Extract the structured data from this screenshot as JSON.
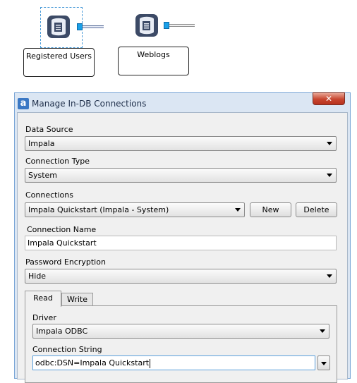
{
  "canvas": {
    "tools": [
      {
        "annotation": "Registered Users",
        "selected": true
      },
      {
        "annotation": "Weblogs",
        "selected": false
      }
    ]
  },
  "dialog": {
    "title": "Manage In-DB Connections",
    "close_symbol": "✕",
    "logo_letter": "a",
    "data_source": {
      "label": "Data Source",
      "value": "Impala"
    },
    "connection_type": {
      "label": "Connection Type",
      "value": "System"
    },
    "connections": {
      "label": "Connections",
      "value": "Impala Quickstart (Impala - System)",
      "new_label": "New",
      "delete_label": "Delete"
    },
    "connection_name": {
      "label": "Connection Name",
      "value": "Impala Quickstart"
    },
    "password_encryption": {
      "label": "Password Encryption",
      "value": "Hide"
    },
    "tabs": [
      {
        "label": "Read",
        "active": true
      },
      {
        "label": "Write",
        "active": false
      }
    ],
    "read": {
      "driver": {
        "label": "Driver",
        "value": "Impala ODBC"
      },
      "connection_string": {
        "label": "Connection String",
        "value": "odbc:DSN=Impala Quickstart"
      }
    }
  },
  "colors": {
    "accent": "#1aa0e8",
    "close": "#c7452f",
    "dialog_frame": "#dbe6f3"
  }
}
